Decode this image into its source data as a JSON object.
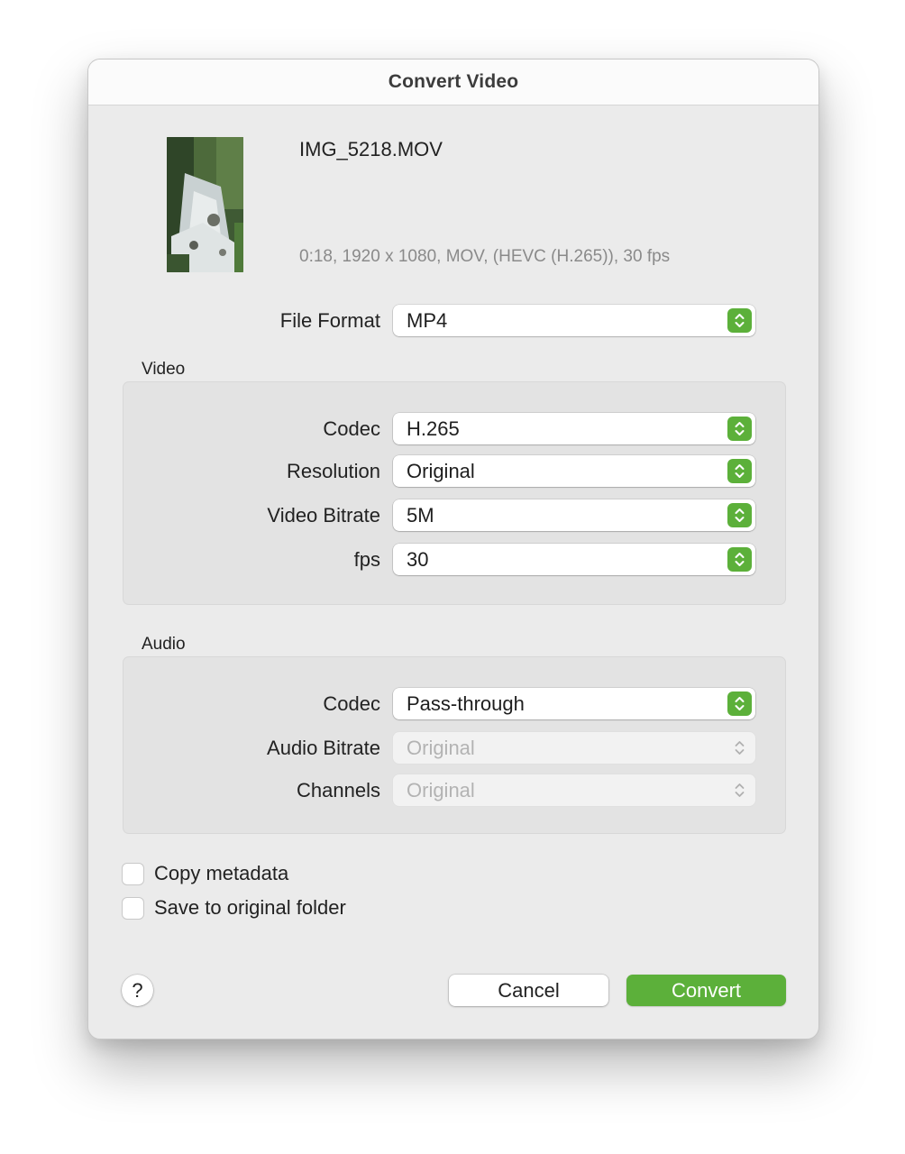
{
  "window": {
    "title": "Convert Video"
  },
  "file": {
    "name": "IMG_5218.MOV",
    "info": "0:18, 1920 x 1080, MOV, (HEVC (H.265)), 30 fps"
  },
  "file_format": {
    "label": "File Format",
    "value": "MP4"
  },
  "video": {
    "title": "Video",
    "codec": {
      "label": "Codec",
      "value": "H.265"
    },
    "resolution": {
      "label": "Resolution",
      "value": "Original"
    },
    "bitrate": {
      "label": "Video Bitrate",
      "value": "5M"
    },
    "fps": {
      "label": "fps",
      "value": "30"
    }
  },
  "audio": {
    "title": "Audio",
    "codec": {
      "label": "Codec",
      "value": "Pass-through"
    },
    "bitrate": {
      "label": "Audio Bitrate",
      "value": "Original",
      "enabled": false
    },
    "channels": {
      "label": "Channels",
      "value": "Original",
      "enabled": false
    }
  },
  "options": {
    "copy_metadata": {
      "label": "Copy metadata",
      "checked": false
    },
    "save_to_original": {
      "label": "Save to original folder",
      "checked": false
    }
  },
  "buttons": {
    "help": "?",
    "cancel": "Cancel",
    "convert": "Convert"
  },
  "colors": {
    "accent": "#5cb03a",
    "window_bg": "#ebebeb",
    "group_bg": "#e3e3e3"
  }
}
